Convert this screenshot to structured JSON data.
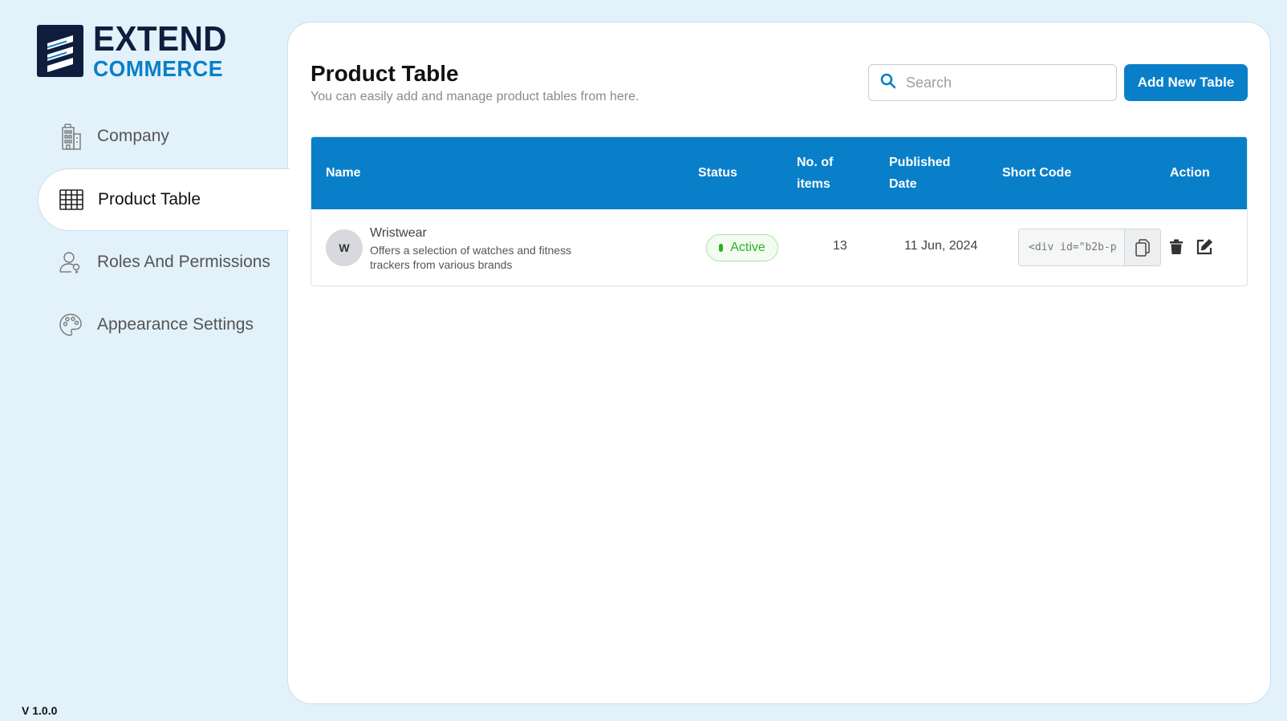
{
  "brand": {
    "line1": "EXTEND",
    "line2": "COMMERCE"
  },
  "sidebar": {
    "items": [
      {
        "label": "Company",
        "icon": "building-icon",
        "active": false
      },
      {
        "label": "Product Table",
        "icon": "table-icon",
        "active": true
      },
      {
        "label": "Roles And Permissions",
        "icon": "user-key-icon",
        "active": false
      },
      {
        "label": "Appearance Settings",
        "icon": "palette-icon",
        "active": false
      }
    ]
  },
  "version": "V 1.0.0",
  "main": {
    "title": "Product Table",
    "subtitle": "You can easily add and manage product tables from here.",
    "search": {
      "placeholder": "Search",
      "value": ""
    },
    "add_button": "Add New Table"
  },
  "table": {
    "columns": {
      "name": "Name",
      "status": "Status",
      "items_line1": "No. of",
      "items_line2": "items",
      "date_line1": "Published",
      "date_line2": "Date",
      "short_code": "Short Code",
      "action": "Action"
    },
    "rows": [
      {
        "avatar": "W",
        "name": "Wristwear",
        "description": "Offers a selection of watches and fitness trackers from various brands",
        "status": "Active",
        "items": "13",
        "published": "11 Jun, 2024",
        "short_code": "<div id=\"b2b-p"
      }
    ]
  },
  "colors": {
    "background": "#e3f1fa",
    "accent": "#0a7fc9",
    "brand_dark": "#0f1e3d",
    "status_active": "#2fae27"
  }
}
